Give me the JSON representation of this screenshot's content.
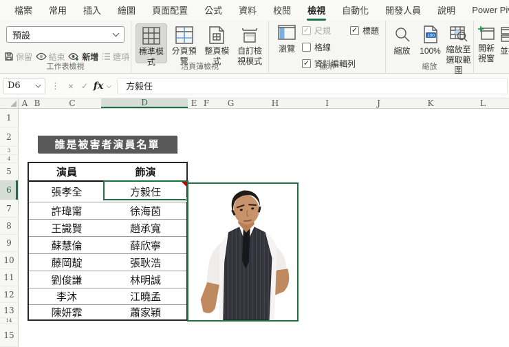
{
  "tabs": {
    "items": [
      "檔案",
      "常用",
      "插入",
      "繪圖",
      "頁面配置",
      "公式",
      "資料",
      "校閱",
      "檢視",
      "自動化",
      "開發人員",
      "說明",
      "Power Pivot"
    ],
    "active": "檢視"
  },
  "ribbon": {
    "sheet_view": {
      "label": "工作表檢視",
      "dropdown_value": "預設",
      "buttons": [
        {
          "label": "保留",
          "icon": "save-icon",
          "disabled": true
        },
        {
          "label": "結束",
          "icon": "eye-end-icon",
          "disabled": true
        },
        {
          "label": "新增",
          "icon": "eye-plus-icon",
          "disabled": false
        },
        {
          "label": "選項",
          "icon": "options-list-icon",
          "disabled": true
        }
      ]
    },
    "workbook_views": {
      "label": "活頁簿檢視",
      "buttons": [
        "標準模式",
        "分頁預覽",
        "整頁模式",
        "自訂檢視模式"
      ],
      "selected": "標準模式"
    },
    "show": {
      "label": "顯示",
      "nav_button": "瀏覽",
      "checkboxes": [
        {
          "label": "尺規",
          "checked": true,
          "disabled": true
        },
        {
          "label": "格線",
          "checked": false,
          "disabled": false
        },
        {
          "label": "資料編輯列",
          "checked": true,
          "disabled": false
        },
        {
          "label": "標題",
          "checked": true,
          "disabled": false
        }
      ]
    },
    "zoom": {
      "label": "縮放",
      "buttons": [
        "縮放",
        "100%",
        "縮放至選取範圍"
      ]
    },
    "window": {
      "buttons": [
        "開新視窗",
        "並排"
      ]
    }
  },
  "formula_bar": {
    "name_box": "D6",
    "formula": "方毅任"
  },
  "grid": {
    "columns": [
      "A",
      "B",
      "C",
      "D",
      "E",
      "F",
      "G",
      "H",
      "I",
      "J",
      "K",
      "L"
    ],
    "selected_column": "D",
    "rows": [
      "1",
      "2",
      "3",
      "4",
      "5",
      "6",
      "7",
      "8",
      "9",
      "10",
      "11",
      "12",
      "13",
      "14",
      "15"
    ],
    "selected_row": "6"
  },
  "sheet": {
    "title": "誰是被害者演員名單",
    "table": {
      "headers": [
        "演員",
        "飾演"
      ],
      "rows": [
        [
          "張孝全",
          "方毅任"
        ],
        [
          "許瑋甯",
          "徐海茵"
        ],
        [
          "王識賢",
          "趙承寬"
        ],
        [
          "蘇慧倫",
          "薛欣寧"
        ],
        [
          "藤岡靛",
          "張耿浩"
        ],
        [
          "劉俊謙",
          "林明誠"
        ],
        [
          "李沐",
          "江曉孟"
        ],
        [
          "陳妍霏",
          "蕭家穎"
        ]
      ]
    },
    "selected_cell": {
      "ref": "D6",
      "value": "方毅任",
      "has_comment": true
    }
  },
  "colors": {
    "accent_green": "#1e7145",
    "title_bg": "#595959",
    "selection_border": "#217346",
    "comment_red": "#c00000"
  }
}
